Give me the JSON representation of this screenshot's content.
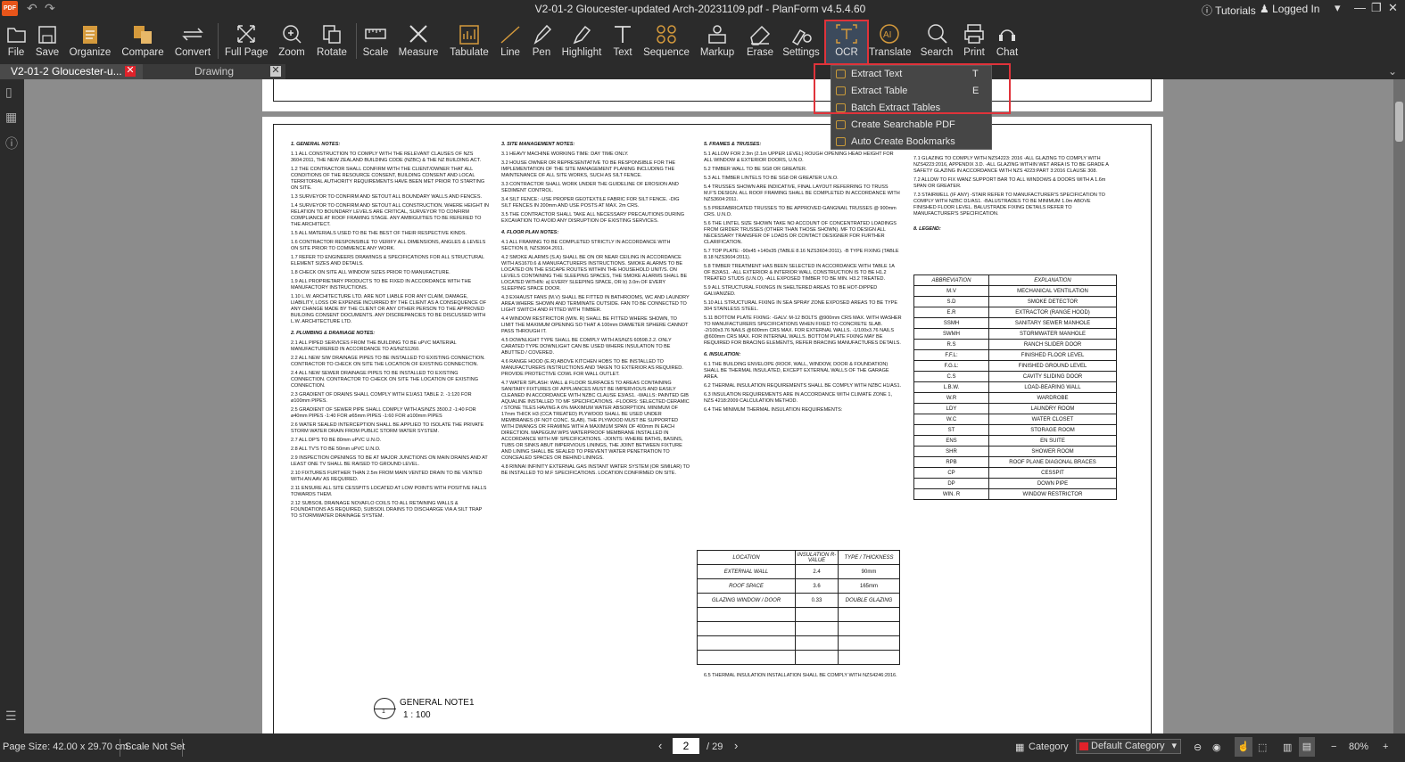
{
  "window": {
    "logo": "PDF",
    "title": "V2-01-2 Gloucester-updated Arch-20231109.pdf - PlanForm v4.5.4.60",
    "tutorials": "Tutorials",
    "logged_in": "Logged In"
  },
  "toolbar": {
    "file": "File",
    "save": "Save",
    "organize": "Organize",
    "compare": "Compare",
    "convert": "Convert",
    "full_page": "Full Page",
    "zoom": "Zoom",
    "rotate": "Rotate",
    "scale": "Scale",
    "measure": "Measure",
    "tabulate": "Tabulate",
    "line": "Line",
    "pen": "Pen",
    "highlight": "Highlight",
    "text": "Text",
    "sequence": "Sequence",
    "markup": "Markup",
    "erase": "Erase",
    "settings": "Settings",
    "ocr": "OCR",
    "translate": "Translate",
    "search": "Search",
    "print": "Print",
    "chat": "Chat"
  },
  "tabs": {
    "doc": "V2-01-2 Gloucester-u...",
    "drawing": "Drawing"
  },
  "ocr_menu": {
    "extract_text": "Extract Text",
    "extract_text_key": "T",
    "extract_table": "Extract Table",
    "extract_table_key": "E",
    "batch_extract": "Batch Extract Tables",
    "searchable_pdf": "Create Searchable PDF",
    "auto_bookmarks": "Auto Create Bookmarks"
  },
  "status": {
    "page_size": "Page Size: 42.00 x 29.70 cm",
    "scale": "Scale Not Set",
    "current_page": "2",
    "total_pages": "/ 29",
    "category_label": "Category",
    "category_value": "Default Category",
    "zoom": "80%"
  },
  "drawing": {
    "general_notes": {
      "heading": "1. GENERAL NOTES:",
      "items": [
        "1.1 ALL CONSTRUCTION TO COMPLY WITH THE RELEVANT CLAUSES OF NZS 3604:2011, THE NEW ZEALAND BUILDING CODE (NZBC) & THE NZ BUILDING ACT.",
        "1.2 THE CONTRACTOR SHALL CONFIRM WITH THE CLIENT/OWNER THAT ALL CONDITIONS OF THE RESOURCE CONSENT, BUILDING CONSENT AND LOCAL TERRITORIAL AUTHORITY REQUIREMENTS HAVE BEEN MET PRIOR TO STARTING ON SITE.",
        "1.3 SURVEYOR TO CONFIRM AND SETOUT ALL BOUNDARY WALLS AND FENCES.",
        "1.4 SURVEYOR TO CONFIRM AND SETOUT ALL CONSTRUCTION. WHERE HEIGHT IN RELATION TO BOUNDARY LEVELS ARE CRITICAL, SURVEYOR TO CONFIRM COMPLIANCE AT ROOF FRAMING STAGE. ANY AMBIGUITIES TO BE REFERED TO THE ARCHITECT.",
        "1.5 ALL MATERIALS USED TO BE THE BEST OF THEIR RESPECTIVE KINDS.",
        "1.6 CONTRACTOR RESPONSIBLE TO VERIFY ALL DIMENSIONS, ANGLES & LEVELS ON SITE PRIOR TO COMMENCE ANY WORK.",
        "1.7 REFER TO ENGINEERS DRAWINGS & SPECIFICATIONS FOR ALL STRUCTURAL ELEMENT SIZES AND DETAILS.",
        "1.8 CHECK ON SITE ALL WINDOW SIZES PRIOR TO MANUFACTURE.",
        "1.9 ALL PROPRIETARY PRODUCTS TO BE FIXED IN ACCORDANCE WITH THE MANUFACTORY INSTRUCTIONS.",
        "1.10 L.W. ARCHITECTURE LTD. ARE NOT LIABLE FOR ANY CLAIM, DAMAGE, LIABILITY, LOSS OR EXPENSE INCURRED BY THE CLIENT AS A CONSEQUENCE OF ANY CHANGE MADE BY THE CLIENT OR ANY OTHER PERSON TO THE APPROVED BUILDING CONSENT DOCUMENTS. ANY DISCREPANCIES TO BE DISCUSSED WITH L.W. ARCHITECTURE LTD."
      ]
    },
    "plumbing": {
      "heading": "2. PLUMBING & DRAINAGE NOTES:",
      "items": [
        "2.1 ALL PIPED SERVICES FROM THE BUILDING TO BE uPVC MATERIAL MANUFACTURERED IN ACCORDANCE TO AS/NZS1260.",
        "2.2 ALL NEW S/W DRAINAGE PIPES TO BE INSTALLED TO EXISTING CONNECTION. CONTRACTOR TO CHECK ON SITE THE LOCATION OF EXISTING CONNECTION.",
        "2.4 ALL NEW SEWER DRAINAGE PIPES TO BE INSTALLED TO EXISTING CONNECTION. CONTRACTOR TO CHECK ON SITE THE LOCATION OF EXISTING CONNECTION.",
        "2.3 GRADIENT OF DRAINS SHALL COMPLY WITH E1/AS1 TABLE 2. -1:120 FOR ø100mm PIPES.",
        "2.5 GRADIENT OF SEWER PIPE SHALL COMPLY WITH AS/NZS 3500.2 -1:40 FOR ø40mm PIPES -1:40 FOR ø65mm PIPES -1:60 FOR ø100mm PIPES",
        "2.6 WATER SEALED INTERCEPTION SHALL BE APPLIED TO ISOLATE THE PRIVATE STORM WATER DRAIN FROM PUBLIC STORM WATER SYSTEM.",
        "2.7 ALL DP'S TO BE 80mm uPVC U.N.O.",
        "2.8 ALL TV'S TO BE 50mm uPVC U.N.O.",
        "2.9 INSPECTION OPENINGS TO BE AT MAJOR JUNCTIONS ON MAIN DRAINS AND AT LEAST ONE TV SHALL BE RAISED TO GROUND LEVEL.",
        "2.10 FIXTURES FURTHER THAN 2.5m FROM MAIN VENTED DRAIN TO BE VENTED WITH AN AAV AS REQUIRED.",
        "2.11 ENSURE ALL SITE CESSPITS LOCATED AT LOW POINTS WITH POSITIVE FALLS TOWARDS THEM.",
        "2.12 SUBSOIL DRAINAGE NOVAFLO COILS TO ALL RETAINING WALLS & FOUNDATIONS AS REQUIRED, SUBSOIL DRAINS TO DISCHARGE VIA A SILT TRAP TO STORMWATER DRAINAGE SYSTEM."
      ]
    },
    "site": {
      "heading": "3. SITE MANAGEMENT NOTES:",
      "items": [
        "3.1 HEAVY MACHINE WORKING TIME: DAY TIME ONLY.",
        "3.2 HOUSE OWNER OR REPRESENTATIVE TO BE RESPONSIBLE FOR THE IMPLEMENTATION OF THE SITE MANAGEMENT PLANING INCLUDING THE MAINTENANCE OF ALL SITE WORKS, SUCH AS SILT FENCE.",
        "3.3 CONTRACTOR SHALL WORK UNDER THE GUIDELINE OF EROSION AND SEDIMENT CONTROL.",
        "3.4 SILT FENCE: -USE PROPER GEOTEXTILE FABRIC FOR SILT FENCE. -DIG SILT FENCES IN 200mm AND USE POSTS AT MAX. 2m CRS.",
        "3.5 THE CONTRACTOR SHALL TAKE ALL NECESSARY PRECAUTIONS DURING EXCAVATION TO AVOID ANY DISRUPTION OF EXISTING SERVICES."
      ]
    },
    "floor": {
      "heading": "4. FLOOR PLAN NOTES:",
      "items": [
        "4.1 ALL FRAMING TO BE COMPLETED STRICTLY IN ACCORDANCE WITH SECTION 8, NZS3604.2011.",
        "4.2 SMOKE ALARMS (S.A) SHALL BE ON OR NEAR CEILING IN ACCORDANCE WITH AS1670.6 & MANUFACTURERS INSTRUCTIONS. SMOKE ALARMS TO BE LOCATED ON THE ESCAPE ROUTES WITHIN THE HOUSEHOLD UNIT/S. ON LEVELS CONTAINING THE SLEEPING SPACES, THE SMOKE ALARMS SHALL BE LOCATED WITHIN: a) EVERY SLEEPING SPACE, OR b) 3.0m OF EVERY SLEEPING SPACE DOOR.",
        "4.3 EXHAUST FANS (M.V) SHALL BE FITTED IN BATHROOMS, WC AND LAUNDRY AREA WHERE SHOWN AND TERMINATE OUTSIDE. FAN TO BE CONNECTED TO LIGHT SWITCH AND FITTED WITH TIMBER.",
        "4.4 WINDOW RESTRICTOR (WIN. R) SHALL BE FITTED WHERE SHOWN, TO LIMIT THE MAXIMUM OPENING SO THAT A 100mm DIAMETER SPHERE CANNOT PASS THROUGH IT.",
        "4.5 DOWNLIGHT TYPE SHALL BE COMPLY WITH AS/NZS 60598.2.2. ONLY CARATED TYPE DOWNLIGHT CAN BE USED WHERE INSULATION TO BE ABUTTED / COVERED.",
        "4.6 RANGE HOOD (E.R) ABOVE KITCHEN HOBS TO BE INSTALLED TO MANUFACTURERS INSTRUCTIONS AND TAKEN TO EXTERIOR AS REQUIRED. PROVIDE PROTECTIVE COWL FOR WALL OUTLET.",
        "4.7 WATER SPLASH: WALL & FLOOR SURFACES TO AREAS CONTAINING SANITARY FIXTURES OF APPLIANCES MUST BE IMPERVIOUS AND EASILY CLEANED IN ACCORDANCE WITH NZBC CLAUSE E3/AS1. -WALLS: PAINTED GIB AQUALINE INSTALLED TO MF SPECIFICATIONS. -FLOORS: SELECTED CERAMIC / STONE TILES HAVING A 6% MAXIMUM WATER ABSORPTION. MINIMUM OF 17mm THICK H3 (CCA TREATED) PLYWOOD SHALL BE USED UNDER MEMBRANES (IF NOT CONC. SLAB). THE PLYWOOD MUST BE SUPPORTED WITH DWANGS OR FRAMING WITH A MAXIMUM SPAN OF 400mm IN EACH DIRECTION. MAPEGUM WPS WATERPROOF MEMBRANE INSTALLED IN ACCORDANCE WITH MF SPECIFICATIONS. -JOINTS: WHERE BATHS, BASINS, TUBS OR SINKS ABUT IMPERVIOUS LININGS, THE JOINT BETWEEN FIXTURE AND LINING SHALL BE SEALED TO PREVENT WATER PENETRATION TO CONCEALED SPACES OR BEHIND LININGS.",
        "4.8 RINNAI INFINITY EXTERNAL GAS INSTANT WATER SYSTEM (OR SIMILAR) TO BE INSTALLED TO M.F SPECIFICATIONS. LOCATION CONFIRMED ON SITE."
      ]
    },
    "frames": {
      "heading": "5. FRAMES & TRUSSES:",
      "items": [
        "5.1 ALLOW FOR 2.3m (2.1m UPPER LEVEL) ROUGH OPENING HEAD HEIGHT FOR ALL WINDOW & EXTERIOR DOORS, U.N.O.",
        "5.2 TIMBER WALL TO BE SG8 OR GREATER.",
        "5.3 ALL TIMBER LINTELS TO BE SG8 OR GREATER U.N.O.",
        "5.4 TRUSSES SHOWN ARE INDICATIVE, FINAL LAYOUT REFERRING TO TRUSS M.F'S DESIGN. ALL ROOF FRAMING SHALL BE COMPLETED IN ACCORDANCE WITH NZS3604:2011.",
        "5.5 PREFABRICATED TRUSSES TO BE APPROVED GANGNAIL TRUSSES @ 900mm CRS. U.N.O.",
        "5.6 THE LINTEL SIZE SHOWN TAKE NO ACCOUNT OF CONCENTRATED LOADINGS FROM GIRDER TRUSSES (OTHER THAN THOSE SHOWN). MF TO DESIGN ALL NECESSARY TRANSFER OF LOADS OR CONTACT DESIGNER FOR FURTHER CLARIFICATION.",
        "5.7 TOP PLATE: -90x45 +140x35 (TABLE 8.16 NZS3604:2011). -B TYPE FIXING (TABLE 8.18 NZS3604:2011).",
        "5.8 TIMBER TREATMENT HAS BEEN SELECTED IN ACCORDANCE WITH TABLE 1A OF B2/AS1. -ALL EXTERIOR & INTERIOR WALL CONSTRUCTION IS TO BE H1.2 TREATED STUDS (U.N.O). -ALL EXPOSED TIMBER TO BE MIN. H3.2 TREATED.",
        "5.9 ALL STRUCTURAL FIXINGS IN SHELTERED AREAS TO BE HOT-DIPPED GALVANIZED.",
        "5.10 ALL STRUCTURAL FIXING IN SEA SPRAY ZONE EXPOSED AREAS TO BE TYPE 304 STAINLESS STEEL.",
        "5.11 BOTTOM PLATE FIXING: -GALV. M-12 BOLTS @900mm CRS MAX. WITH WASHER TO MANUFACTURERS SPECIFICATIONS WHEN FIXED TO CONCRETE SLAB. -2/100x3.76 NAILS @600mm CRS MAX. FOR EXTERNAL WALLS. -1/100x3.76 NAILS @600mm CRS MAX. FOR INTERNAL WALLS. BOTTOM PLATE FIXING MAY BE REQUIRED FOR BRACING ELEMENTS, REFER BRACING MANUFACTURES DETAILS."
      ]
    },
    "insulation": {
      "heading": "6. INSULATION:",
      "items": [
        "6.1 THE BUILDING ENVELOPE (ROOF, WALL, WINDOW, DOOR & FOUNDATION) SHALL BE THERMAL INSULATED, EXCEPT EXTERNAL WALLS OF THE GARAGE AREA.",
        "6.2 THERMAL INSULATION REQUIREMENTS SHALL BE COMPLY WITH NZBC H1/AS1.",
        "6.3 INSULATION REQUIREMENTS ARE IN ACCORDANCE WITH CLIMATE ZONE 1, NZS 4218:2009 CALCULATION METHOD.",
        "6.4 THE MINIMUM THERMAL INSULATION REQUIREMENTS:"
      ],
      "table_headers": [
        "LOCATION",
        "INSULATION R-VALUE",
        "TYPE / THICKNESS"
      ],
      "table_rows": [
        [
          "EXTERNAL WALL",
          "2.4",
          "90mm"
        ],
        [
          "ROOF SPACE",
          "3.6",
          "165mm"
        ],
        [
          "GLAZING WINDOW / DOOR",
          "0.33",
          "DOUBLE GLAZING"
        ]
      ],
      "footer": "6.5 THERMAL INSULATION INSTALLATION SHALL BE COMPLY WITH NZS4246:2016."
    },
    "glazing": {
      "items": [
        "7.1 GLAZING TO COMPLY WITH NZS4223: 2016 -ALL GLAZING TO COMPLY WITH NZS4223:2016, APPENDIX 3.D. -ALL GLAZING WITHIN WET AREA IS TO BE GRADE A SAFETY GLAZING IN ACCORDANCE WITH NZS 4223:PART 3:2016 CLAUSE 308.",
        "7.2 ALLOW TO FIX WANZ SUPPORT BAR TO ALL WINDOWS & DOORS WITH A 1.6m SPAN OR GREATER.",
        "7.3 STAIRWELL (IF ANY) -STAIR REFER TO MANUFACTURER'S SPECIFICATION TO COMPLY WITH NZBC D1/AS1. -BALUSTRADES TO BE MINIMUM 1.0m ABOVE FINISHED FLOOR LEVEL. BALUSTRADE FIXING DETAILS REFER TO MANUFACTURER'S SPECIFICATION."
      ]
    },
    "legend": {
      "heading": "8. LEGEND:",
      "headers": [
        "ABBREVIATION",
        "EXPLANATION"
      ],
      "rows": [
        [
          "M.V",
          "MECHANICAL VENTILATION"
        ],
        [
          "S.D",
          "SMOKE DETECTOR"
        ],
        [
          "E.R",
          "EXTRACTOR (RANGE HOOD)"
        ],
        [
          "SSMH",
          "SANITARY SEWER MANHOLE"
        ],
        [
          "SWMH",
          "STORMWATER MANHOLE"
        ],
        [
          "R.S",
          "RANCH SLIDER DOOR"
        ],
        [
          "F.F.L:",
          "FINISHED FLOOR LEVEL"
        ],
        [
          "F.G.L:",
          "FINISHED GROUND LEVEL"
        ],
        [
          "C.S",
          "CAVITY SLIDING DOOR"
        ],
        [
          "L.B.W.",
          "LOAD-BEARING WALL"
        ],
        [
          "W.R",
          "WARDROBE"
        ],
        [
          "LDY",
          "LAUNDRY ROOM"
        ],
        [
          "W.C",
          "WATER CLOSET"
        ],
        [
          "ST",
          "STORAGE ROOM"
        ],
        [
          "ENS",
          "EN SUITE"
        ],
        [
          "SHR",
          "SHOWER ROOM"
        ],
        [
          "RPB",
          "ROOF PLANE DIAGONAL BRACES"
        ],
        [
          "CP",
          "CESSPIT"
        ],
        [
          "DP",
          "DOWN PIPE"
        ],
        [
          "WIN. R",
          "WINDOW RESTRICTOR"
        ]
      ]
    },
    "general_note_label": "GENERAL NOTE1",
    "general_note_scale": "1 : 100"
  }
}
